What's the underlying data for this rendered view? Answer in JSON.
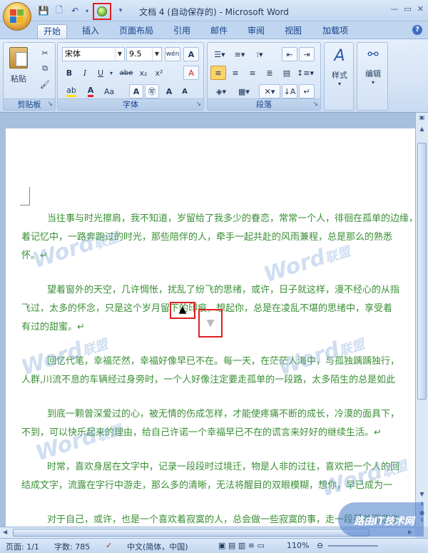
{
  "title": "文档 4 (自动保存的) - Microsoft Word",
  "window_controls": [
    "—",
    "▭",
    "✕"
  ],
  "tabs": [
    {
      "label": "开始",
      "active": true
    },
    {
      "label": "插入"
    },
    {
      "label": "页面布局"
    },
    {
      "label": "引用"
    },
    {
      "label": "邮件"
    },
    {
      "label": "审阅"
    },
    {
      "label": "视图"
    },
    {
      "label": "加载项"
    }
  ],
  "help_label": "?",
  "clipboard": {
    "paste_label": "粘贴",
    "caption": "剪贴板"
  },
  "font": {
    "font_name": "宋体",
    "font_size": "9.5",
    "wen_label": "wén",
    "caption": "字体",
    "bold": "B",
    "italic": "I",
    "underline": "U",
    "strikethrough": "abe",
    "subscript": "x₂",
    "superscript": "x²",
    "clear": "A",
    "grow": "A",
    "shrink": "A",
    "changecase": "Aa",
    "shade": "A"
  },
  "paragraph": {
    "caption": "段落"
  },
  "styles": {
    "label": "样式"
  },
  "editing": {
    "label": "编辑"
  },
  "document": {
    "paragraphs": [
      [
        "当往事与时光擦肩，我不知道，岁留给了我多少的眷恋，常常一个人，徘徊在孤单的边缘，",
        "着记忆中，一路奔跑过的时光，那些陪伴的人，牵手一起共赴的风雨兼程，总是那么的熟悉",
        "怀。↵"
      ],
      [
        "望着窗外的天空，几许惆怅，扰乱了纷飞的思绪，或许，日子就这样，漫不经心的从指",
        "飞过，太多的怀念，只是这个岁月留下的印痕，想起你，总是在凌乱不堪的思绪中，享受着",
        "有过的甜蜜。↵"
      ],
      [
        "回忆代笔，幸福茫然，幸福好像早已不在。每一天，在茫茫人海中，与孤独踽踽独行，",
        "人群,川流不息的车辆经过身旁时，一个人好像注定要走孤单的一段路，太多陌生的总是如此"
      ],
      [
        "到底一颗曾深爱过的心，被无情的伤成怎样，才能使疼痛不断的成长，冷漠的面具下，",
        "不到，可以快乐起来的理由，给自己许诺一个幸福早已不在的谎言来好好的继续生活。↵"
      ],
      [
        "时常，喜欢身居在文字中，记录一段段时过境迁，物是人非的过往，喜欢把一个人的回",
        "结成文字，流露在字行中游走，那么多的清晰，无法将醒目的双眼模糊，想你，早已成为一"
      ],
      [
        "对于自己，或许，也是一个喜欢着寂寞的人，总会做一些寂寞的事，走一段孤单而悲伤"
      ]
    ],
    "watermark": "Word联盟",
    "watermark_url": "www.wordlm.com"
  },
  "status_bar": {
    "page": "页面: 1/1",
    "words": "字数: 785",
    "language": "中文(简体，中国)",
    "zoom": "110%"
  },
  "corner_logo": "路由IT技术网"
}
